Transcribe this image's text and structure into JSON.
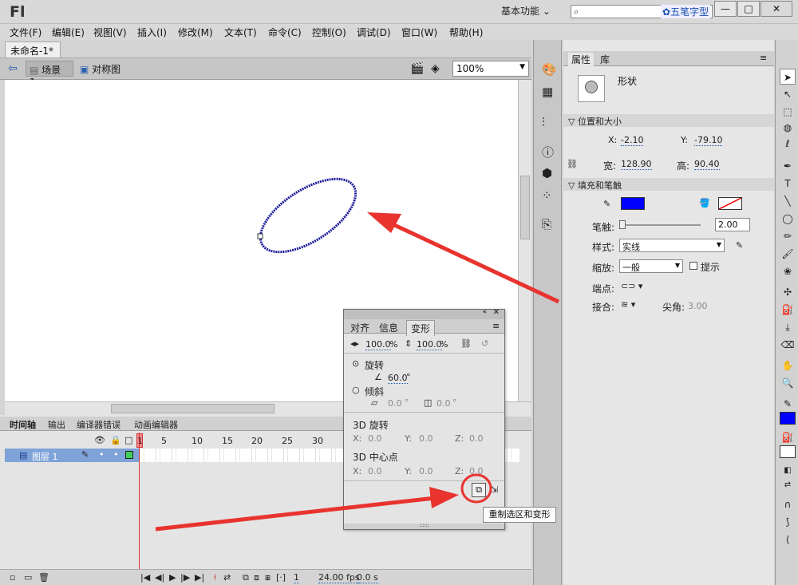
{
  "app": {
    "logo": "Fl",
    "workspace": "基本功能 ⌄",
    "search_brand": "五笔字型"
  },
  "menu": [
    "文件(F)",
    "编辑(E)",
    "视图(V)",
    "插入(I)",
    "修改(M)",
    "文本(T)",
    "命令(C)",
    "控制(O)",
    "调试(D)",
    "窗口(W)",
    "帮助(H)"
  ],
  "document": {
    "tab": "未命名-1*",
    "close": "×",
    "scene": "场景 1",
    "symbol": "对称图",
    "zoom": "100%"
  },
  "timeline": {
    "tabs": [
      "时间轴",
      "输出",
      "编译器错误",
      "动画编辑器"
    ],
    "frame_numbers": [
      "1",
      "5",
      "10",
      "15",
      "20",
      "25",
      "30"
    ],
    "layer_name": "图层 1",
    "current_frame": "1",
    "fps": "24.00 fps",
    "time": "0.0 s"
  },
  "properties": {
    "tabs": [
      "属性",
      "库"
    ],
    "type": "形状",
    "sections": {
      "position": "位置和大小",
      "fill": "填充和笔触"
    },
    "x_label": "X:",
    "x": "-2.10",
    "y_label": "Y:",
    "y": "-79.10",
    "w_label": "宽:",
    "w": "128.90",
    "h_label": "高:",
    "h": "90.40",
    "stroke_label": "笔触:",
    "stroke_value": "2.00",
    "style_label": "样式:",
    "style_value": "实线",
    "scale_label": "缩放:",
    "scale_value": "一般",
    "hint_label": "提示",
    "cap_label": "端点:",
    "join_label": "接合:",
    "miter_label": "尖角:",
    "miter_value": "3.00",
    "stroke_color": "#0000ff"
  },
  "transform_panel": {
    "tabs": [
      "对齐",
      "信息",
      "变形"
    ],
    "scale_w": "100.0",
    "scale_h": "100.0",
    "pct": "%",
    "rotate_label": "旋转",
    "rotate_value": "60.0",
    "deg": "°",
    "skew_label": "倾斜",
    "skew_h": "0.0",
    "skew_v": "0.0",
    "rot3d_label": "3D 旋转",
    "rot3d_x": "0.0",
    "rot3d_y": "0.0",
    "rot3d_z": "0.0",
    "center3d_label": "3D 中心点",
    "center3d_x": "0.0",
    "center3d_y": "0.0",
    "center3d_z": "0.0",
    "x_label": "X:",
    "y_label": "Y:",
    "z_label": "Z:"
  },
  "tooltip": "重制选区和变形",
  "colors": {
    "ellipse": "#1a1a9a",
    "arrow": "#e8332e",
    "fill_swatch": "#0000ff"
  }
}
